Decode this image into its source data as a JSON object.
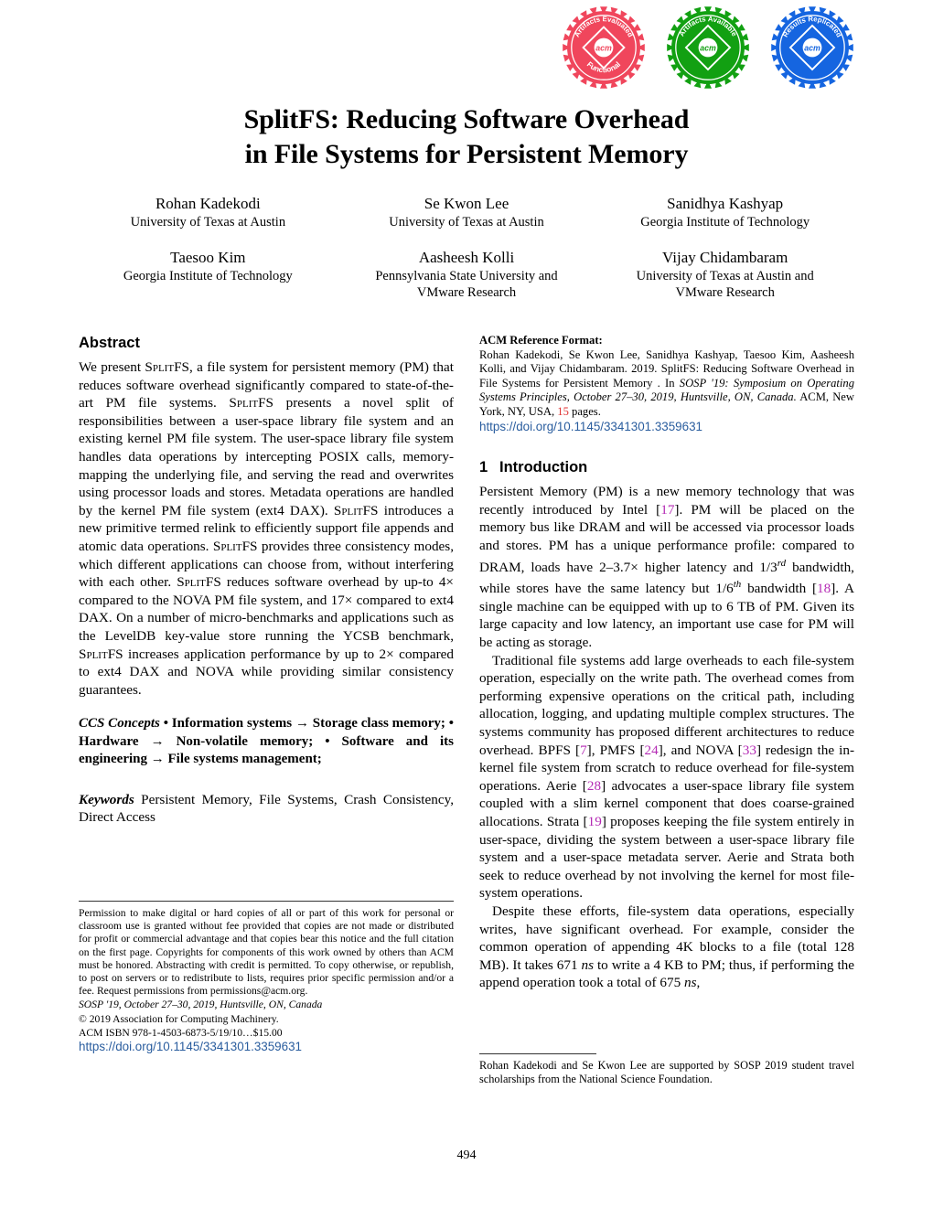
{
  "badges": [
    {
      "name": "artifacts-evaluated-functional",
      "top_text": "Artifacts  Evaluated",
      "bottom_text": "Functional",
      "center_text": "acm",
      "color": "#f0465c"
    },
    {
      "name": "artifacts-available",
      "top_text": "Artifacts  Available",
      "bottom_text": "",
      "center_text": "acm",
      "color": "#12a012"
    },
    {
      "name": "results-replicated",
      "top_text": "Results  Replicated",
      "bottom_text": "",
      "center_text": "acm",
      "color": "#1565e0"
    }
  ],
  "title": {
    "line1": "SplitFS: Reducing Software Overhead",
    "line2": "in File Systems for Persistent Memory"
  },
  "authors": [
    {
      "name": "Rohan Kadekodi",
      "affiliation": "University of Texas at Austin"
    },
    {
      "name": "Se Kwon Lee",
      "affiliation": "University of Texas at Austin"
    },
    {
      "name": "Sanidhya Kashyap",
      "affiliation": "Georgia Institute of Technology"
    },
    {
      "name": "Taesoo Kim",
      "affiliation": "Georgia Institute of Technology"
    },
    {
      "name": "Aasheesh Kolli",
      "affiliation": "Pennsylvania State University and\nVMware Research"
    },
    {
      "name": "Vijay Chidambaram",
      "affiliation": "University of Texas at Austin and\nVMware Research"
    }
  ],
  "abstract": {
    "heading": "Abstract",
    "text": "We present SplitFS, a file system for persistent memory (PM) that reduces software overhead significantly compared to state-of-the-art PM file systems. SplitFS presents a novel split of responsibilities between a user-space library file system and an existing kernel PM file system. The user-space library file system handles data operations by intercepting POSIX calls, memory-mapping the underlying file, and serving the read and overwrites using processor loads and stores. Metadata operations are handled by the kernel PM file system (ext4 DAX). SplitFS introduces a new primitive termed relink to efficiently support file appends and atomic data operations. SplitFS provides three consistency modes, which different applications can choose from, without interfering with each other. SplitFS reduces software overhead by up-to 4× compared to the NOVA PM file system, and 17× compared to ext4 DAX. On a number of micro-benchmarks and applications such as the LevelDB key-value store running the YCSB benchmark, SplitFS increases application performance by up to 2× compared to ext4 DAX and NOVA while providing similar consistency guarantees."
  },
  "ccs": {
    "lead": "CCS Concepts",
    "text": "• Information systems → Storage class memory; • Hardware → Non-volatile memory; • Software and its engineering → File systems management;"
  },
  "keywords": {
    "lead": "Keywords",
    "text": "Persistent Memory, File Systems, Crash Consistency, Direct Access"
  },
  "permission": {
    "body": "Permission to make digital or hard copies of all or part of this work for personal or classroom use is granted without fee provided that copies are not made or distributed for profit or commercial advantage and that copies bear this notice and the full citation on the first page. Copyrights for components of this work owned by others than ACM must be honored. Abstracting with credit is permitted. To copy otherwise, or republish, to post on servers or to redistribute to lists, requires prior specific permission and/or a fee. Request permissions from permissions@acm.org.",
    "venue": "SOSP '19, October 27–30, 2019, Huntsville, ON, Canada",
    "copyright": "© 2019 Association for Computing Machinery.",
    "isbn": "ACM ISBN 978-1-4503-6873-5/19/10…$15.00",
    "doi": "https://doi.org/10.1145/3341301.3359631"
  },
  "acm_reference": {
    "heading": "ACM Reference Format:",
    "part1": "Rohan Kadekodi, Se Kwon Lee, Sanidhya Kashyap, Taesoo Kim, Aasheesh Kolli, and Vijay Chidambaram. 2019. SplitFS: Reducing Software Overhead in File Systems for Persistent Memory . In ",
    "italic_part": "SOSP '19: Symposium on Operating Systems Principles, October 27–30, 2019, Huntsville, ON, Canada.",
    "part2": " ACM, New York, NY, USA, ",
    "pages_number": "15",
    "part3": " pages.",
    "doi": "https://doi.org/10.1145/3341301.3359631"
  },
  "introduction": {
    "section_number": "1",
    "heading": "Introduction",
    "para1_a": "Persistent Memory (PM) is a new memory technology that was recently introduced by Intel [",
    "cite1": "17",
    "para1_b": "]. PM will be placed on the memory bus like DRAM and will be accessed via processor loads and stores. PM has a unique performance profile: compared to DRAM, loads have 2–3.7× higher latency and 1/3",
    "ord1": "rd",
    "para1_c": " bandwidth, while stores have the same latency but 1/6",
    "ord2": "th",
    "para1_d": " bandwidth [",
    "cite2": "18",
    "para1_e": "]. A single machine can be equipped with up to 6 TB of PM. Given its large capacity and low latency, an important use case for PM will be acting as storage.",
    "para2_a": "Traditional file systems add large overheads to each file-system operation, especially on the write path. The overhead comes from performing expensive operations on the critical path, including allocation, logging, and updating multiple complex structures. The systems community has proposed different architectures to reduce overhead. BPFS [",
    "cite3": "7",
    "para2_b": "], PMFS [",
    "cite4": "24",
    "para2_c": "], and NOVA [",
    "cite5": "33",
    "para2_d": "] redesign the in-kernel file system from scratch to reduce overhead for file-system operations. Aerie [",
    "cite6": "28",
    "para2_e": "] advocates a user-space library file system coupled with a slim kernel component that does coarse-grained allocations. Strata [",
    "cite7": "19",
    "para2_f": "] proposes keeping the file system entirely in user-space, dividing the system between a user-space library file system and a user-space metadata server. Aerie and Strata both seek to reduce overhead by not involving the kernel for most file-system operations.",
    "para3_a": "Despite these efforts, file-system data operations, especially writes, have significant overhead. For example, consider the common operation of appending 4K blocks to a file (total 128 MB). It takes 671 ",
    "ns1": "ns",
    "para3_b": " to write a 4 KB to PM; thus, if performing the append operation took a total of 675 ",
    "ns2": "ns",
    "para3_c": ","
  },
  "footnote": {
    "text": "Rohan Kadekodi and Se Kwon Lee are supported by SOSP 2019 student travel scholarships from the National Science Foundation."
  },
  "page_number": "494",
  "colors": {
    "citation": "#b42ab4",
    "link": "#2a5d9e",
    "pages_red": "#e03030"
  }
}
